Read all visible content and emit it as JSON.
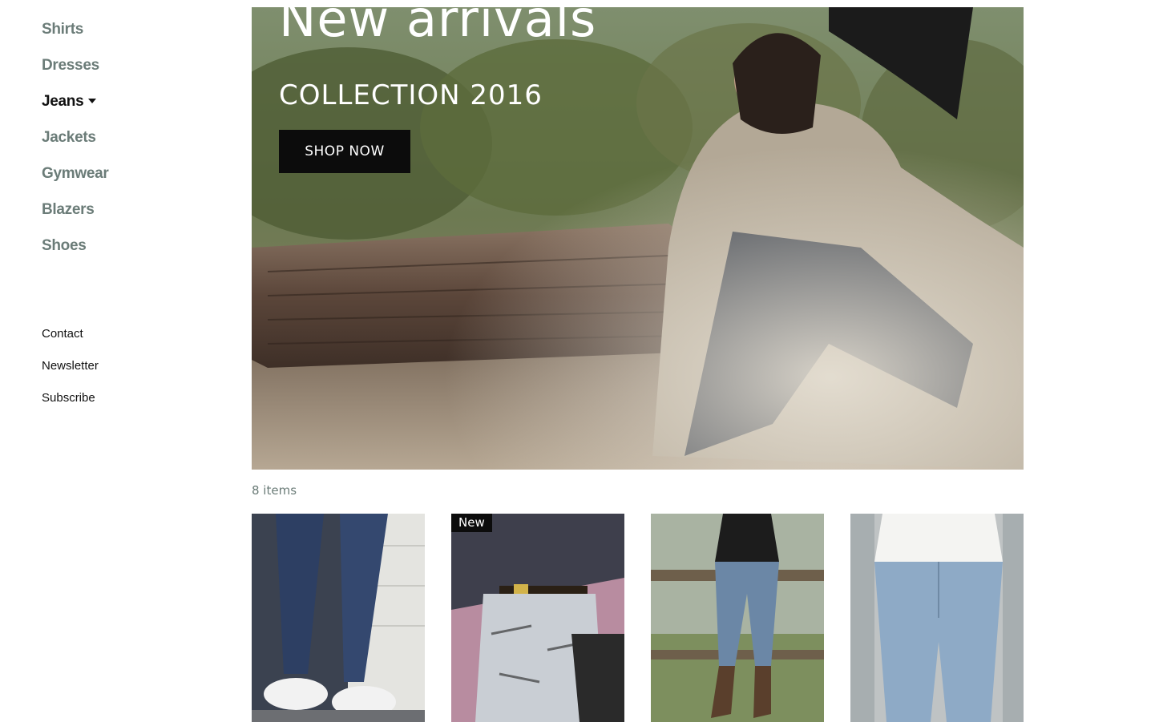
{
  "sidebar": {
    "categories": [
      {
        "label": "Shirts"
      },
      {
        "label": "Dresses"
      },
      {
        "label": "Jeans"
      },
      {
        "label": "Jackets"
      },
      {
        "label": "Gymwear"
      },
      {
        "label": "Blazers"
      },
      {
        "label": "Shoes"
      }
    ],
    "active_category": "Jeans",
    "secondary_links": [
      {
        "label": "Contact"
      },
      {
        "label": "Newsletter"
      },
      {
        "label": "Subscribe"
      }
    ]
  },
  "hero": {
    "title": "New arrivals",
    "subtitle": "COLLECTION 2016",
    "cta_label": "SHOP NOW"
  },
  "catalog": {
    "items_count": "8 items",
    "products": [
      {
        "image": "ripped skinny jeans with white sneakers",
        "badge": ""
      },
      {
        "image": "distressed biker jeans with belt and bag",
        "badge": "New"
      },
      {
        "image": "light jeans with cowboy boots on fence",
        "badge": ""
      },
      {
        "image": "light blue skinny jeans with white shirt",
        "badge": ""
      }
    ]
  },
  "colors": {
    "nav_text": "#6b7c78",
    "nav_active": "#111111",
    "button_bg": "#0c0c0c"
  }
}
